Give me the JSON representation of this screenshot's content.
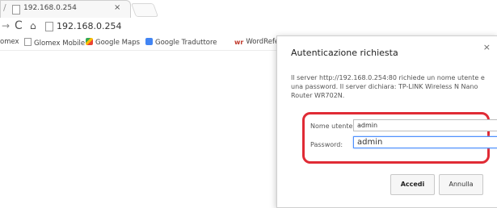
{
  "tab": {
    "title": "192.168.0.254",
    "close": "×"
  },
  "toolbar": {
    "forward": "→",
    "reload": "C",
    "home": "⌂",
    "url": "192.168.0.254"
  },
  "bookmarks": [
    {
      "label": "omex",
      "icon": "none"
    },
    {
      "label": "Glomex Mobile",
      "icon": "page-icon"
    },
    {
      "label": "Google Maps",
      "icon": "google-maps-icon"
    },
    {
      "label": "Google Traduttore",
      "icon": "google-translate-icon"
    },
    {
      "label": "WordRefe",
      "icon": "wordreference-icon"
    }
  ],
  "dialog": {
    "title": "Autenticazione richiesta",
    "close": "×",
    "message": "Il server http://192.168.0.254:80 richiede un nome utente e una password. Il server dichiara: TP-LINK Wireless N Nano Router WR702N.",
    "username_label": "Nome utente:",
    "username_value": "admin",
    "password_label": "Password:",
    "password_value": "admin",
    "login_button": "Accedi",
    "cancel_button": "Annulla"
  },
  "colors": {
    "highlight": "#e02b35",
    "focus": "#4d90fe"
  }
}
